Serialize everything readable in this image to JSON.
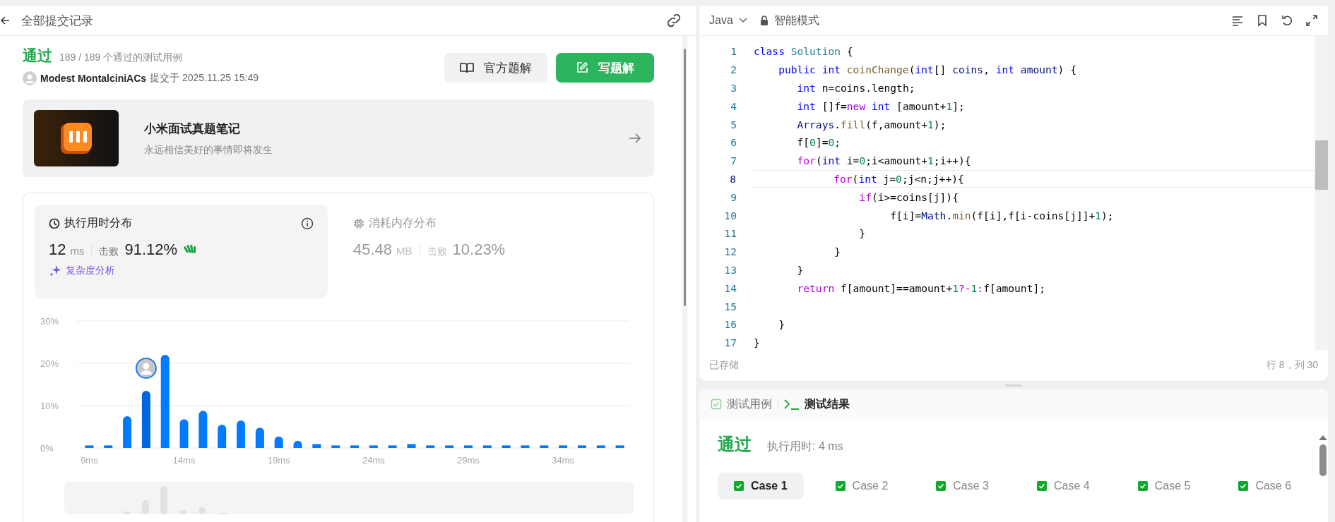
{
  "submission": {
    "header": {
      "title": "全部提交记录"
    },
    "result": {
      "status": "通过",
      "cases": "189 / 189 个通过的测试用例",
      "user": "Modest MontalciniACs",
      "submitted": "提交于 2025.11.25 15:49"
    },
    "buttons": [
      {
        "label": "官方题解",
        "kind": "secondary"
      },
      {
        "label": "写题解",
        "kind": "primary"
      }
    ],
    "banner": {
      "title": "小米面试真题笔记",
      "subtitle": "永远相信美好的事情即将发生"
    },
    "stats": [
      {
        "kind": "runtime",
        "title": "执行用时分布",
        "value": "12",
        "unit": "ms",
        "beat_label": "击败",
        "beat": "91.12%",
        "selected": true,
        "link": "复杂度分析"
      },
      {
        "kind": "memory",
        "title": "消耗内存分布",
        "value": "45.48",
        "unit": "MB",
        "beat_label": "击败",
        "beat": "10.23%",
        "selected": false
      }
    ],
    "chart_data": {
      "type": "bar",
      "x": [
        9,
        10,
        11,
        12,
        13,
        14,
        15,
        16,
        17,
        18,
        19,
        20,
        21,
        22,
        23,
        24,
        25,
        26,
        27,
        28,
        29,
        30,
        31,
        32,
        33,
        34,
        35,
        36,
        37
      ],
      "series": [
        {
          "color": "#007aff",
          "values": [
            0.6,
            0.6,
            7.5,
            null,
            22,
            6.8,
            8.8,
            5.5,
            6.5,
            4.8,
            2.7,
            1.7,
            0.9,
            0.6,
            0.6,
            0.6,
            0.6,
            0.9,
            0.6,
            0.6,
            0.6,
            0.6,
            0.6,
            0.6,
            0.6,
            0.6,
            0.6,
            0.6,
            0.6
          ]
        },
        {
          "color": "#0066dd",
          "values": [
            null,
            null,
            null,
            13.5,
            null,
            null,
            null,
            null,
            null,
            null,
            null,
            null,
            null,
            null,
            null,
            null,
            null,
            null,
            null,
            null,
            null,
            null,
            null,
            null,
            null,
            null,
            null,
            null,
            null
          ]
        }
      ],
      "xlim": [
        8.5,
        37.5
      ],
      "ylim": [
        0,
        30
      ],
      "yticks": [
        {
          "value": 0,
          "label": "0%"
        },
        {
          "value": 10,
          "label": "10%"
        },
        {
          "value": 20,
          "label": "20%"
        },
        {
          "value": 30,
          "label": "30%"
        }
      ],
      "xticks": [
        {
          "value": 9,
          "label": "9ms"
        },
        {
          "value": 14,
          "label": "14ms"
        },
        {
          "value": 19,
          "label": "19ms"
        },
        {
          "value": 24,
          "label": "24ms"
        },
        {
          "value": 29,
          "label": "29ms"
        },
        {
          "value": 34,
          "label": "34ms"
        }
      ]
    }
  },
  "editor": {
    "language": "Java",
    "mode": "智能模式",
    "lines": [
      {
        "number": "1",
        "current": false,
        "tokens": [
          {
            "t": "class ",
            "kind": "kw"
          },
          {
            "t": "Solution",
            "kind": "cls"
          },
          {
            "t": " {"
          }
        ]
      },
      {
        "number": "2",
        "current": false,
        "tokens": [
          {
            "t": "    public int ",
            "kind": "kw"
          },
          {
            "t": "coinChange",
            "kind": "fn"
          },
          {
            "t": "("
          },
          {
            "t": "int",
            "kind": "kw"
          },
          {
            "t": "[] "
          },
          {
            "t": "coins",
            "kind": "var"
          },
          {
            "t": ", "
          },
          {
            "t": "int ",
            "kind": "kw"
          },
          {
            "t": "amount",
            "kind": "var"
          },
          {
            "t": ") {"
          }
        ]
      },
      {
        "number": "3",
        "current": false,
        "tokens": [
          {
            "t": "       int",
            "kind": "kw"
          },
          {
            "t": " n=coins.length;"
          }
        ]
      },
      {
        "number": "4",
        "current": false,
        "tokens": [
          {
            "t": "       int",
            "kind": "kw"
          },
          {
            "t": " []f="
          },
          {
            "t": "new ",
            "kind": "ctl"
          },
          {
            "t": "int",
            "kind": "kw"
          },
          {
            "t": " [amount+"
          },
          {
            "t": "1",
            "kind": "num"
          },
          {
            "t": "];"
          }
        ]
      },
      {
        "number": "5",
        "current": false,
        "tokens": [
          {
            "t": "       Arrays",
            "kind": "var"
          },
          {
            "t": "."
          },
          {
            "t": "fill",
            "kind": "fn"
          },
          {
            "t": "(f,amount+"
          },
          {
            "t": "1",
            "kind": "num"
          },
          {
            "t": ");"
          }
        ]
      },
      {
        "number": "6",
        "current": false,
        "tokens": [
          {
            "t": "       f["
          },
          {
            "t": "0",
            "kind": "num"
          },
          {
            "t": "]="
          },
          {
            "t": "0",
            "kind": "num"
          },
          {
            "t": ";"
          }
        ]
      },
      {
        "number": "7",
        "current": false,
        "tokens": [
          {
            "t": "       for",
            "kind": "ctl"
          },
          {
            "t": "("
          },
          {
            "t": "int",
            "kind": "kw"
          },
          {
            "t": " i="
          },
          {
            "t": "0",
            "kind": "num"
          },
          {
            "t": ";i<amount+"
          },
          {
            "t": "1",
            "kind": "num"
          },
          {
            "t": ";i++){"
          }
        ]
      },
      {
        "number": "8",
        "current": true,
        "tokens": [
          {
            "t": "             for",
            "kind": "ctl"
          },
          {
            "t": "("
          },
          {
            "t": "int",
            "kind": "kw"
          },
          {
            "t": " j="
          },
          {
            "t": "0",
            "kind": "num"
          },
          {
            "t": ";j<n;j++){"
          }
        ]
      },
      {
        "number": "9",
        "current": false,
        "tokens": [
          {
            "t": "                 if",
            "kind": "ctl"
          },
          {
            "t": "(i>=coins[j]){"
          }
        ]
      },
      {
        "number": "10",
        "current": false,
        "tokens": [
          {
            "t": "                      f[i]="
          },
          {
            "t": "Math",
            "kind": "var"
          },
          {
            "t": "."
          },
          {
            "t": "min",
            "kind": "fn"
          },
          {
            "t": "(f[i],f[i-coins[j]]+"
          },
          {
            "t": "1",
            "kind": "num"
          },
          {
            "t": ");"
          }
        ]
      },
      {
        "number": "11",
        "current": false,
        "tokens": [
          {
            "t": "                 }"
          }
        ]
      },
      {
        "number": "12",
        "current": false,
        "tokens": [
          {
            "t": "             }"
          }
        ]
      },
      {
        "number": "13",
        "current": false,
        "tokens": [
          {
            "t": "       }"
          }
        ]
      },
      {
        "number": "14",
        "current": false,
        "tokens": [
          {
            "t": "       return",
            "kind": "ctl"
          },
          {
            "t": " f[amount]==amount+"
          },
          {
            "t": "1",
            "kind": "num"
          },
          {
            "t": "?-",
            "kind": "ctl"
          },
          {
            "t": "1",
            "kind": "num"
          },
          {
            "t": ":",
            "kind": "ctl"
          },
          {
            "t": "f[amount];"
          }
        ]
      },
      {
        "number": "15",
        "current": false
      },
      {
        "number": "16",
        "current": false,
        "tokens": [
          {
            "t": "    }"
          }
        ]
      },
      {
        "number": "17",
        "current": false,
        "tokens": [
          {
            "t": "}"
          }
        ]
      }
    ],
    "status": "已存储",
    "cursor": "行 8，列 30"
  },
  "console": {
    "tabs": [
      {
        "label": "测试用例",
        "kind": "cases",
        "selected": false
      },
      {
        "label": "测试结果",
        "kind": "result",
        "selected": true
      }
    ],
    "status": "通过",
    "runtime": "执行用时: 4 ms",
    "cases": [
      {
        "label": "Case 1",
        "checked": true,
        "selected": true
      },
      {
        "label": "Case 2",
        "checked": true,
        "selected": false
      },
      {
        "label": "Case 3",
        "checked": true,
        "selected": false
      },
      {
        "label": "Case 4",
        "checked": true,
        "selected": false
      },
      {
        "label": "Case 5",
        "checked": true,
        "selected": false
      },
      {
        "label": "Case 6",
        "checked": true,
        "selected": false
      }
    ]
  }
}
